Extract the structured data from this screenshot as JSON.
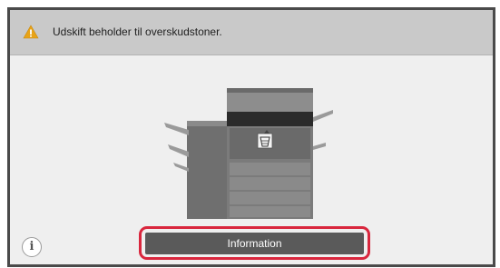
{
  "header": {
    "message": "Udskift beholder til overskudstoner.",
    "icon": "warning-icon",
    "icon_color": "#e8a317"
  },
  "main": {
    "illustration": "multifunction-printer-with-toner-waste-indicator"
  },
  "footer": {
    "info_icon": "info-icon",
    "info_icon_glyph": "i",
    "button_label": "Information",
    "highlight_color": "#d9263d"
  }
}
